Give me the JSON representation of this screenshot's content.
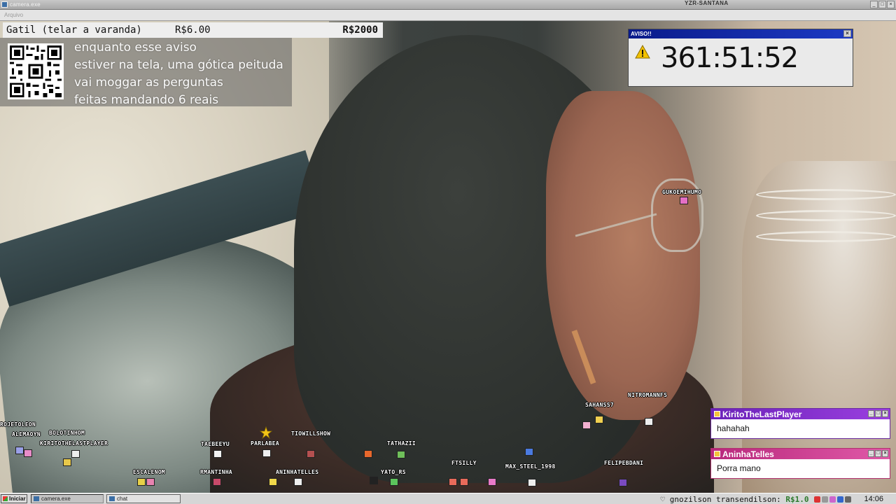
{
  "window": {
    "title": "camera.exe",
    "user": "YZR-SANTANA",
    "menu": "Arquivo",
    "controls": [
      "_",
      "□",
      "×"
    ]
  },
  "goal": {
    "name": "Gatil (telar a varanda)",
    "current": "R$6.00",
    "target": "R$2000"
  },
  "notice": {
    "lines": [
      "enquanto esse aviso",
      "estiver na tela, uma gótica peituda",
      "vai moggar as perguntas",
      "feitas mandando 6 reais"
    ]
  },
  "aviso": {
    "title": "AVISO!!",
    "close": "×",
    "timer": "361:51:52",
    "icon": "warning-icon",
    "warn_color": "#f2c100"
  },
  "avatars": [
    "GUKOEMIHUMO",
    "ROJETOLEON",
    "ALEMAOYN",
    "BOLOTINHOM",
    "KIRITOTHELASTPLAYER",
    "TAEBEEYU",
    "PARLABEA",
    "TIOWILLSHOW",
    "TATHAZII",
    "ESCALENOM",
    "RMANTINHA",
    "ANINHATELLES",
    "YATO_RS",
    "FTSILLY",
    "MAX_STEEL_1998",
    "SAHANSS7",
    "NITROMANNFS",
    "FELIPEBDANI"
  ],
  "chat": [
    {
      "user": "KiritoTheLastPlayer",
      "message": "hahahah",
      "color": "#7a2ac8"
    },
    {
      "user": "AninhaTelles",
      "message": "Porra mano",
      "color": "#c8338c"
    }
  ],
  "taskbar": {
    "start": "Iniciar",
    "tasks": [
      "camera.exe",
      "chat"
    ],
    "donation_user": "♡ gnozilson transendilson:",
    "donation_amount": "R$1.0",
    "clock": "14:06"
  }
}
